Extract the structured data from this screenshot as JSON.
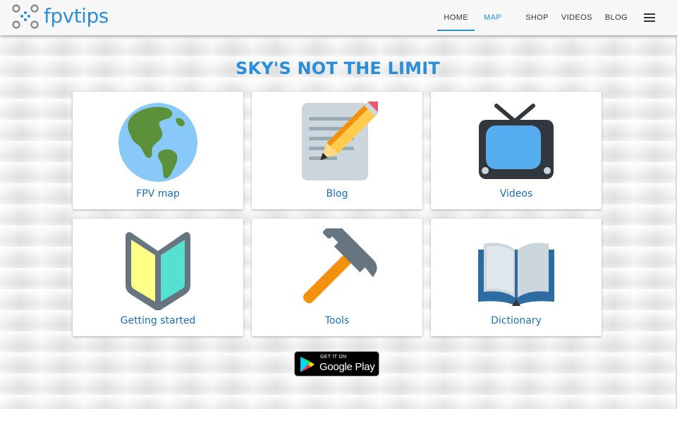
{
  "header": {
    "logo_text": "fpvtips",
    "nav": [
      {
        "label": "HOME"
      },
      {
        "label": "MAP"
      },
      {
        "label": "SHOP"
      },
      {
        "label": "VIDEOS"
      },
      {
        "label": "BLOG"
      }
    ],
    "menu_icon": "hamburger-icon",
    "accent_color": "#2a8fd8"
  },
  "main": {
    "headline": "SKY'S NOT THE LIMIT",
    "cards": [
      {
        "label": "FPV map",
        "icon": "globe-icon"
      },
      {
        "label": "Blog",
        "icon": "pencil-notepad-icon"
      },
      {
        "label": "Videos",
        "icon": "television-icon"
      },
      {
        "label": "Getting started",
        "icon": "beginner-badge-icon"
      },
      {
        "label": "Tools",
        "icon": "hammer-icon"
      },
      {
        "label": "Dictionary",
        "icon": "open-book-icon"
      }
    ],
    "store_badge": {
      "small": "GET IT ON",
      "big": "Google Play"
    }
  }
}
